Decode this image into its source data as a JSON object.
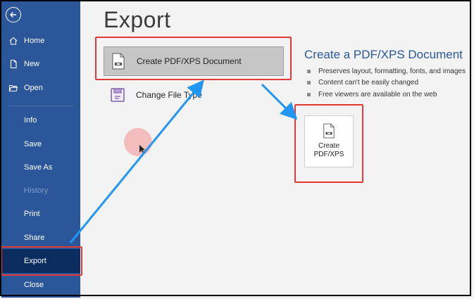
{
  "sidebar": {
    "items": [
      {
        "label": "Home",
        "icon": "home-icon"
      },
      {
        "label": "New",
        "icon": "new-document-icon"
      },
      {
        "label": "Open",
        "icon": "folder-open-icon"
      },
      {
        "label": "Info"
      },
      {
        "label": "Save"
      },
      {
        "label": "Save As"
      },
      {
        "label": "History"
      },
      {
        "label": "Print"
      },
      {
        "label": "Share"
      },
      {
        "label": "Export"
      },
      {
        "label": "Close"
      }
    ],
    "active_item": "Export",
    "background": "#2b579a",
    "active_background": "#0b2c5f"
  },
  "main": {
    "title": "Export",
    "options": [
      {
        "label": "Create PDF/XPS Document",
        "icon": "pdf-document-icon",
        "selected": true
      },
      {
        "label": "Change File Type",
        "icon": "change-file-type-icon",
        "selected": false
      }
    ]
  },
  "pane": {
    "title": "Create a PDF/XPS Document",
    "bullets": [
      "Preserves layout, formatting, fonts, and images",
      "Content can't be easily changed",
      "Free viewers are available on the web"
    ],
    "button_line1": "Create",
    "button_line2": "PDF/XPS"
  },
  "annotations": {
    "highlight_color": "#e53935",
    "arrow_color": "#2196f3"
  }
}
